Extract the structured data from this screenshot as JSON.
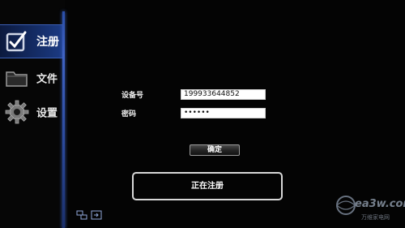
{
  "sidebar": {
    "items": [
      {
        "label": "注册",
        "icon": "checkbox-pen-icon",
        "active": true
      },
      {
        "label": "文件",
        "icon": "folder-icon",
        "active": false
      },
      {
        "label": "设置",
        "icon": "gear-icon",
        "active": false
      }
    ],
    "bottom_icons": [
      "input-switch-icon",
      "input-source-icon"
    ]
  },
  "form": {
    "device_label": "设备号",
    "device_value": "199933644852",
    "password_label": "密码",
    "password_value": "••••••",
    "confirm_label": "确定"
  },
  "status": {
    "text": "正在注册"
  },
  "watermark": {
    "text": "ea3w.com",
    "subtext": "万维家电网"
  },
  "colors": {
    "accent": "#2b4fa8",
    "background": "#040404"
  }
}
